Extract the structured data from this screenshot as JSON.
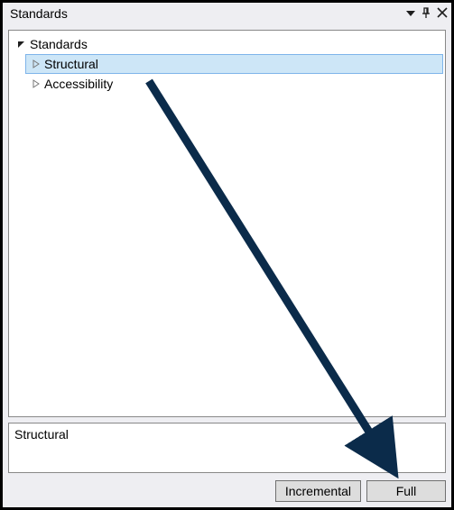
{
  "panel": {
    "title": "Standards"
  },
  "tree": {
    "root": {
      "label": "Standards",
      "expanded": true
    },
    "children": [
      {
        "label": "Structural",
        "expanded": false,
        "selected": true
      },
      {
        "label": "Accessibility",
        "expanded": false,
        "selected": false
      }
    ]
  },
  "info": {
    "selected_name": "Structural"
  },
  "buttons": {
    "incremental": "Incremental",
    "full": "Full"
  }
}
